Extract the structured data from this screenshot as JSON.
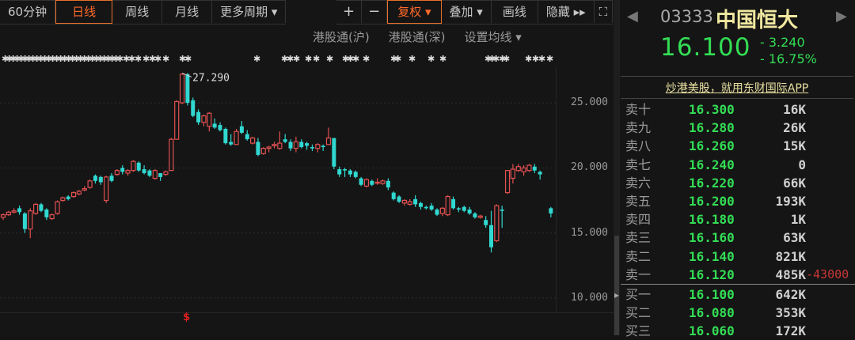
{
  "toolbar": {
    "periods": [
      "60分钟",
      "日线",
      "周线",
      "月线",
      "更多周期 ▾"
    ],
    "active_period": "日线",
    "plus": "+",
    "minus": "−",
    "fuquan": "复权 ▾",
    "overlay": "叠加 ▾",
    "draw": "画线",
    "hide": "隐藏 ▸▸",
    "fullscreen": "⛶"
  },
  "subbar": {
    "hk_sh": "港股通(沪)",
    "hk_sz": "港股通(深)",
    "ma_setting": "设置均线 ▾"
  },
  "stock": {
    "code": "03333",
    "name": "中国恒大",
    "price": "16.100",
    "change": "- 3.240",
    "change_pct": "- 16.75%",
    "prev_arrow": "◀",
    "next_arrow": "▶"
  },
  "ad_text": "炒港美股，就用东财国际APP",
  "order_book": [
    {
      "label": "卖十",
      "price": "16.300",
      "vol": "16K"
    },
    {
      "label": "卖九",
      "price": "16.280",
      "vol": "26K"
    },
    {
      "label": "卖八",
      "price": "16.260",
      "vol": "15K"
    },
    {
      "label": "卖七",
      "price": "16.240",
      "vol": "0"
    },
    {
      "label": "卖六",
      "price": "16.220",
      "vol": "66K"
    },
    {
      "label": "卖五",
      "price": "16.200",
      "vol": "193K"
    },
    {
      "label": "卖四",
      "price": "16.180",
      "vol": "1K"
    },
    {
      "label": "卖三",
      "price": "16.160",
      "vol": "63K"
    },
    {
      "label": "卖二",
      "price": "16.140",
      "vol": "821K"
    },
    {
      "label": "卖一",
      "price": "16.120",
      "vol": "485K",
      "delta": "-43000"
    },
    {
      "label": "买一",
      "price": "16.100",
      "vol": "642K"
    },
    {
      "label": "买二",
      "price": "16.080",
      "vol": "353K"
    },
    {
      "label": "买三",
      "price": "16.060",
      "vol": "172K"
    }
  ],
  "colors": {
    "up": "#e05050",
    "down": "#30d8d0",
    "accent": "#e8702a",
    "green": "#33dd55"
  },
  "chart_data": {
    "type": "candlestick",
    "y_ticks": [
      "25.000",
      "20.000",
      "15.000",
      "10.000"
    ],
    "ylim": [
      8.9,
      27.74
    ],
    "max_label": "27.290",
    "marker": "$",
    "candles": [
      [
        16.2,
        16.5,
        16.0,
        16.4
      ],
      [
        16.4,
        16.7,
        16.3,
        16.6
      ],
      [
        16.6,
        16.9,
        16.5,
        16.7
      ],
      [
        16.9,
        17.1,
        16.4,
        16.6
      ],
      [
        16.5,
        16.6,
        15.0,
        15.3
      ],
      [
        15.3,
        16.9,
        14.6,
        16.7
      ],
      [
        16.5,
        17.3,
        16.4,
        17.2
      ],
      [
        17.2,
        17.3,
        16.6,
        16.7
      ],
      [
        16.8,
        16.9,
        16.0,
        16.2
      ],
      [
        16.1,
        16.5,
        16.0,
        16.4
      ],
      [
        16.5,
        17.5,
        16.4,
        17.4
      ],
      [
        17.5,
        17.8,
        17.4,
        17.7
      ],
      [
        17.8,
        17.9,
        17.5,
        17.6
      ],
      [
        17.8,
        18.2,
        17.7,
        18.1
      ],
      [
        18.0,
        18.3,
        17.9,
        18.2
      ],
      [
        18.3,
        18.6,
        18.2,
        18.4
      ],
      [
        18.5,
        19.1,
        18.4,
        19.0
      ],
      [
        19.4,
        19.5,
        18.8,
        19.0
      ],
      [
        19.3,
        19.4,
        18.7,
        18.9
      ],
      [
        17.5,
        19.4,
        17.3,
        19.3
      ],
      [
        19.4,
        19.6,
        18.9,
        19.0
      ],
      [
        19.5,
        19.9,
        19.4,
        19.8
      ],
      [
        20.0,
        20.2,
        19.5,
        19.7
      ],
      [
        19.6,
        19.9,
        19.4,
        19.8
      ],
      [
        19.8,
        20.6,
        19.7,
        20.5
      ],
      [
        20.4,
        20.5,
        19.7,
        19.8
      ],
      [
        19.9,
        20.2,
        19.5,
        19.6
      ],
      [
        19.8,
        19.9,
        19.3,
        19.4
      ],
      [
        19.2,
        19.9,
        19.1,
        19.8
      ],
      [
        19.6,
        19.6,
        19.0,
        19.3
      ],
      [
        19.5,
        19.8,
        19.4,
        19.7
      ],
      [
        19.8,
        22.3,
        19.8,
        22.2
      ],
      [
        22.2,
        25.2,
        22.2,
        25.1
      ],
      [
        25.0,
        27.29,
        24.9,
        27.2
      ],
      [
        27.2,
        27.3,
        24.8,
        25.0
      ],
      [
        25.2,
        25.4,
        23.9,
        24.0
      ],
      [
        24.3,
        24.5,
        23.3,
        23.5
      ],
      [
        23.5,
        24.1,
        23.2,
        24.0
      ],
      [
        23.2,
        24.3,
        22.8,
        24.2
      ],
      [
        23.4,
        23.8,
        23.0,
        23.1
      ],
      [
        23.3,
        23.5,
        22.8,
        22.9
      ],
      [
        23.0,
        23.1,
        21.8,
        21.9
      ],
      [
        22.0,
        22.6,
        21.7,
        21.8
      ],
      [
        21.8,
        23.0,
        21.8,
        22.8
      ],
      [
        23.2,
        23.6,
        22.6,
        22.7
      ],
      [
        22.6,
        22.9,
        22.1,
        22.2
      ],
      [
        21.9,
        22.4,
        21.8,
        22.3
      ],
      [
        22.0,
        22.3,
        20.9,
        21.0
      ],
      [
        21.1,
        21.6,
        21.0,
        21.5
      ],
      [
        21.5,
        21.7,
        21.2,
        21.6
      ],
      [
        21.7,
        22.0,
        21.5,
        21.8
      ],
      [
        21.5,
        22.8,
        21.4,
        21.9
      ],
      [
        22.2,
        22.6,
        21.9,
        22.0
      ],
      [
        22.0,
        22.2,
        21.3,
        21.5
      ],
      [
        21.5,
        22.4,
        21.2,
        22.0
      ],
      [
        22.0,
        22.2,
        21.5,
        21.6
      ],
      [
        21.9,
        22.0,
        21.4,
        21.7
      ],
      [
        21.6,
        21.8,
        21.3,
        21.5
      ],
      [
        21.5,
        21.9,
        21.2,
        21.8
      ],
      [
        21.7,
        21.8,
        21.3,
        21.6
      ],
      [
        21.8,
        23.1,
        21.8,
        22.3
      ],
      [
        22.3,
        22.3,
        19.9,
        20.1
      ],
      [
        19.9,
        20.1,
        19.3,
        19.5
      ],
      [
        19.9,
        20.0,
        19.3,
        19.8
      ],
      [
        19.8,
        19.9,
        19.3,
        19.5
      ],
      [
        19.7,
        19.8,
        19.2,
        19.3
      ],
      [
        19.2,
        19.3,
        18.6,
        18.7
      ],
      [
        18.6,
        19.2,
        18.5,
        19.1
      ],
      [
        19.0,
        19.1,
        18.6,
        18.7
      ],
      [
        18.9,
        19.2,
        18.7,
        18.9
      ],
      [
        18.8,
        19.1,
        18.7,
        19.0
      ],
      [
        19.0,
        19.2,
        18.3,
        18.5
      ],
      [
        18.1,
        18.2,
        17.5,
        17.6
      ],
      [
        17.8,
        17.9,
        17.3,
        17.4
      ],
      [
        17.3,
        17.6,
        17.1,
        17.5
      ],
      [
        17.2,
        17.6,
        17.1,
        17.4
      ],
      [
        17.6,
        17.9,
        17.0,
        17.2
      ],
      [
        17.3,
        17.4,
        16.8,
        17.0
      ],
      [
        17.0,
        17.1,
        16.8,
        16.9
      ],
      [
        17.1,
        17.3,
        16.7,
        16.8
      ],
      [
        16.8,
        16.9,
        16.3,
        16.4
      ],
      [
        16.5,
        17.0,
        16.3,
        16.9
      ],
      [
        16.4,
        17.9,
        16.3,
        17.8
      ],
      [
        17.6,
        17.8,
        16.8,
        16.9
      ],
      [
        16.9,
        17.0,
        16.6,
        16.8
      ],
      [
        17.0,
        17.1,
        16.6,
        16.7
      ],
      [
        16.8,
        17.0,
        16.4,
        16.5
      ],
      [
        16.5,
        16.6,
        16.1,
        16.2
      ],
      [
        16.2,
        16.4,
        16.1,
        16.3
      ],
      [
        16.0,
        16.3,
        15.4,
        15.6
      ],
      [
        15.6,
        16.7,
        13.5,
        13.9
      ],
      [
        14.4,
        17.2,
        14.3,
        17.1
      ],
      [
        16.8,
        17.1,
        15.4,
        16.7
      ],
      [
        18.1,
        19.8,
        18.0,
        19.8
      ],
      [
        19.2,
        20.3,
        18.8,
        19.9
      ],
      [
        19.8,
        20.3,
        19.7,
        20.1
      ],
      [
        19.7,
        20.2,
        19.4,
        20.0
      ],
      [
        19.8,
        20.3,
        19.7,
        20.2
      ],
      [
        20.1,
        20.3,
        19.6,
        19.8
      ],
      [
        19.7,
        19.8,
        19.1,
        19.5
      ],
      null,
      [
        16.9,
        17.0,
        16.2,
        16.5
      ]
    ]
  }
}
